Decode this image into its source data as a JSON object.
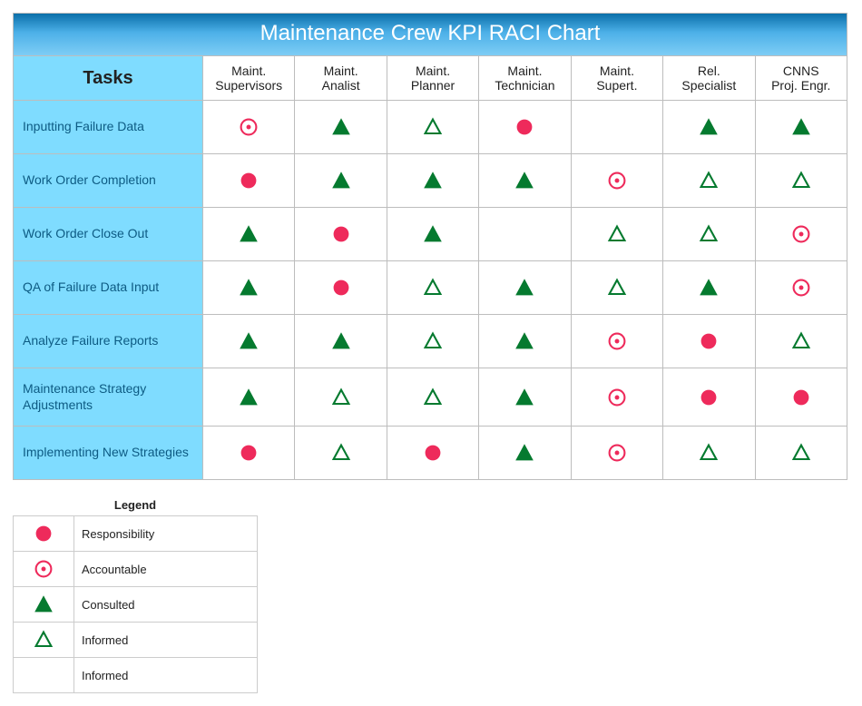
{
  "title": "Maintenance Crew KPI RACI Chart",
  "tasks_header": "Tasks",
  "roles": [
    "Maint.\nSupervisors",
    "Maint.\nAnalist",
    "Maint.\nPlanner",
    "Maint.\nTechnician",
    "Maint.\nSupert.",
    "Rel.\nSpecialist",
    "CNNS\nProj. Engr."
  ],
  "tasks": [
    "Inputting Failure Data",
    "Work Order Completion",
    "Work Order Close Out",
    "QA of Failure Data Input",
    "Analyze Failure Reports",
    "Maintenance Strategy Adjustments",
    "Implementing New Strategies"
  ],
  "chart_data": {
    "type": "table",
    "title": "Maintenance Crew KPI RACI Chart",
    "row_labels": [
      "Inputting Failure Data",
      "Work Order Completion",
      "Work Order Close Out",
      "QA of Failure Data Input",
      "Analyze Failure Reports",
      "Maintenance Strategy Adjustments",
      "Implementing New Strategies"
    ],
    "column_labels": [
      "Maint. Supervisors",
      "Maint. Analist",
      "Maint. Planner",
      "Maint. Technician",
      "Maint. Supert.",
      "Rel. Specialist",
      "CNNS Proj. Engr."
    ],
    "value_meaning": {
      "R": "Responsibility",
      "A": "Accountable",
      "C": "Consulted",
      "I": "Informed",
      "": "Blank"
    },
    "matrix": [
      [
        "A",
        "C",
        "I",
        "R",
        "",
        "C",
        "C"
      ],
      [
        "R",
        "C",
        "C",
        "C",
        "A",
        "I",
        "I"
      ],
      [
        "C",
        "R",
        "C",
        "",
        "I",
        "I",
        "A"
      ],
      [
        "C",
        "R",
        "I",
        "C",
        "I",
        "C",
        "A"
      ],
      [
        "C",
        "C",
        "I",
        "C",
        "A",
        "R",
        "I"
      ],
      [
        "C",
        "I",
        "I",
        "C",
        "A",
        "R",
        "R"
      ],
      [
        "R",
        "I",
        "R",
        "C",
        "A",
        "I",
        "I"
      ]
    ]
  },
  "legend": {
    "title": "Legend",
    "items": [
      {
        "sym": "R",
        "label": "Responsibility"
      },
      {
        "sym": "A",
        "label": "Accountable"
      },
      {
        "sym": "C",
        "label": "Consulted"
      },
      {
        "sym": "I",
        "label": "Informed"
      },
      {
        "sym": "",
        "label": "Informed"
      }
    ]
  },
  "colors": {
    "red": "#ee2a5b",
    "green": "#057a2f",
    "header_blue": "#7fdcff"
  }
}
